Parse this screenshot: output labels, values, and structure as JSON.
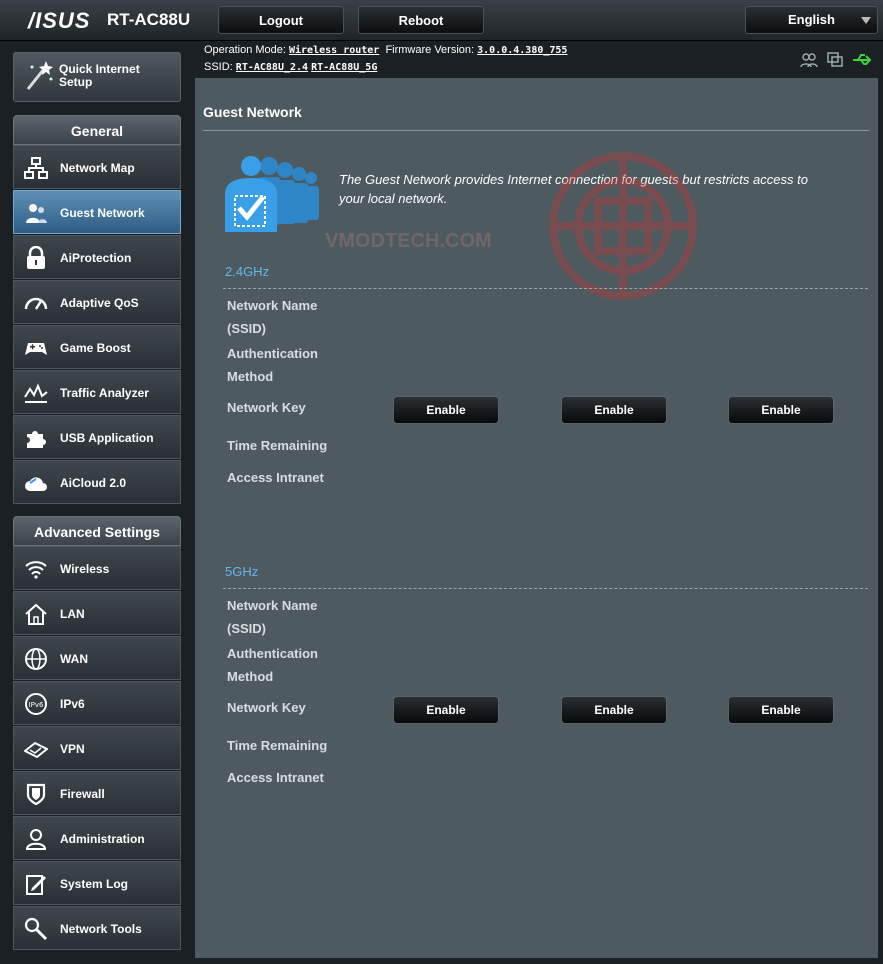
{
  "header": {
    "logo": "/ISUS",
    "model": "RT-AC88U",
    "logout_label": "Logout",
    "reboot_label": "Reboot",
    "language": "English"
  },
  "info": {
    "op_mode_label": "Operation Mode:",
    "op_mode_value": "Wireless router",
    "fw_label": "Firmware Version:",
    "fw_value": "3.0.0.4.380_755",
    "ssid_label": "SSID:",
    "ssid_24": "RT-AC88U_2.4",
    "ssid_5": "RT-AC88U_5G"
  },
  "sidebar": {
    "qis_label_line1": "Quick Internet",
    "qis_label_line2": "Setup",
    "general_header": "General",
    "general_items": [
      {
        "label": "Network Map",
        "icon": "network-map-icon"
      },
      {
        "label": "Guest Network",
        "icon": "guest-network-icon",
        "active": true
      },
      {
        "label": "AiProtection",
        "icon": "lock-icon"
      },
      {
        "label": "Adaptive QoS",
        "icon": "speedometer-icon"
      },
      {
        "label": "Game Boost",
        "icon": "gamepad-icon"
      },
      {
        "label": "Traffic Analyzer",
        "icon": "traffic-chart-icon"
      },
      {
        "label": "USB Application",
        "icon": "puzzle-icon"
      },
      {
        "label": "AiCloud 2.0",
        "icon": "cloud-icon"
      }
    ],
    "advanced_header": "Advanced Settings",
    "advanced_items": [
      {
        "label": "Wireless",
        "icon": "wifi-icon"
      },
      {
        "label": "LAN",
        "icon": "home-icon"
      },
      {
        "label": "WAN",
        "icon": "globe-icon"
      },
      {
        "label": "IPv6",
        "icon": "ipv6-icon"
      },
      {
        "label": "VPN",
        "icon": "vpn-icon"
      },
      {
        "label": "Firewall",
        "icon": "shield-icon"
      },
      {
        "label": "Administration",
        "icon": "user-icon"
      },
      {
        "label": "System Log",
        "icon": "log-icon"
      },
      {
        "label": "Network Tools",
        "icon": "tools-icon"
      }
    ]
  },
  "main": {
    "title": "Guest Network",
    "description": "The Guest Network provides Internet connection for guests but restricts access to your local network.",
    "watermark": "VMODTECH.COM",
    "bands": [
      {
        "name": "2.4GHz",
        "rows": [
          "Network Name",
          "(SSID)",
          "Authentication",
          "Method",
          "Network Key",
          "Time Remaining",
          "Access Intranet"
        ],
        "buttons": [
          "Enable",
          "Enable",
          "Enable"
        ]
      },
      {
        "name": "5GHz",
        "rows": [
          "Network Name",
          "(SSID)",
          "Authentication",
          "Method",
          "Network Key",
          "Time Remaining",
          "Access Intranet"
        ],
        "buttons": [
          "Enable",
          "Enable",
          "Enable"
        ]
      }
    ]
  },
  "colors": {
    "accent_blue": "#69b4e8",
    "panel": "#4d5a60",
    "active_menu": "#4a7ca3"
  }
}
